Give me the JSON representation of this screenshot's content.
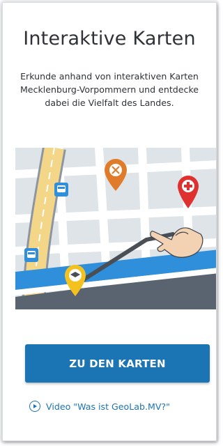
{
  "card": {
    "title": "Interaktive Karten",
    "description": "Erkunde anhand von interaktiven Karten Mecklenburg-Vorpommern und entdecke dabei die Vielfalt des Landes.",
    "cta_label": "ZU DEN KARTEN",
    "video_link": "Video \"Was ist GeoLab.MV?\""
  },
  "map": {
    "icons": [
      "bus-stop-icon",
      "restaurant-pin-icon",
      "hospital-pin-icon",
      "school-pin-icon",
      "pointing-hand-icon"
    ]
  },
  "colors": {
    "accent": "#1b74b3",
    "road_yellow": "#f4d689",
    "water": "#2f8fda",
    "pin_orange": "#e07b2a",
    "pin_red": "#e03131",
    "pin_yellow": "#f3c21f"
  }
}
